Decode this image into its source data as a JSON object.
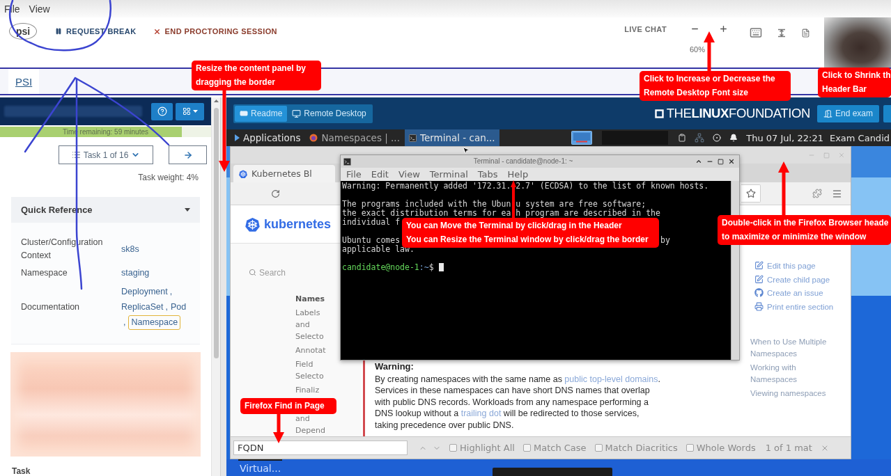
{
  "menu_bar": {
    "items": [
      "File",
      "View"
    ]
  },
  "header": {
    "logo": "psi",
    "actions": [
      {
        "kind": "pause",
        "label": "REQUEST BREAK"
      },
      {
        "kind": "end",
        "label": "END PROCTORING SESSION"
      }
    ],
    "live_chat": "LIVE CHAT",
    "font_zoom": "60%"
  },
  "sub_tabs": [
    {
      "label": "PSI",
      "selected": true
    }
  ],
  "left_panel": {
    "timer": {
      "text": "Time remaining: 59 minutes",
      "level": 0.86
    },
    "task_selector": "Task 1 of 16",
    "task_weight": "Task weight: 4%",
    "quick_reference": {
      "title": "Quick Reference",
      "expanded": true,
      "rows": [
        {
          "kind": "text",
          "label": "Cluster/Configuration Context",
          "value": "sk8s"
        },
        {
          "kind": "text",
          "label": "Namespace",
          "value": "staging"
        },
        {
          "kind": "links",
          "label": "Documentation",
          "separator": ",",
          "links": [
            {
              "text": "Deployment",
              "focused": false
            },
            {
              "text": "ReplicaSet",
              "focused": false
            },
            {
              "text": "Pod",
              "focused": false
            },
            {
              "text": "Namespace",
              "focused": true
            }
          ]
        }
      ]
    },
    "section_heading": "Task"
  },
  "remote_panel": {
    "tabs": [
      {
        "label": "Readme",
        "selected": true
      },
      {
        "label": "Remote Desktop",
        "selected": false
      }
    ],
    "logo": "THE**LINUX**FOUNDATION",
    "end_exam": "End exam"
  },
  "desktop": {
    "taskbar": {
      "items": [
        {
          "kind": "menu",
          "label": "Applications",
          "selected": false
        },
        {
          "kind": "browser",
          "label": "Namespaces | ...",
          "selected": false
        },
        {
          "kind": "terminal",
          "label": "Terminal - can...",
          "selected": true
        }
      ],
      "clock": "Thu 07 Jul, 22:21",
      "user": "Exam Candid"
    },
    "firefox": {
      "tab": "Kubernetes Bl",
      "logo": "kubernetes",
      "search_placeholder": "Search",
      "nav": {
        "heading": "Names",
        "items": [
          {
            "lines": [
              "Labels",
              "and",
              "Selecto"
            ]
          },
          {
            "lines": [
              "Annotat"
            ]
          },
          {
            "lines": [
              "Field",
              "Selecto"
            ]
          },
          {
            "lines": [
              "Finaliz"
            ]
          },
          {
            "lines": [
              "and",
              "Depend"
            ]
          }
        ]
      },
      "warning": {
        "title": "Warning:",
        "parts": [
          {
            "kind": "text",
            "text": "By creating namespaces with the same name as "
          },
          {
            "kind": "link",
            "text": "public top-level"
          },
          {
            "kind": "link",
            "text": "domains"
          },
          {
            "kind": "text",
            "text": ". Services in these namespaces can have short DNS names that overlap with public DNS records. Workloads from any namespace performing a DNS lookup without a "
          },
          {
            "kind": "link",
            "text": "trailing dot"
          },
          {
            "kind": "text",
            "text": " will be redirected to those services, taking precedence over public DNS."
          }
        ]
      },
      "page_actions": [
        "Edit this page",
        "Create child page",
        "Create an issue",
        "Print entire section"
      ],
      "toc": [
        "When to Use Multiple Namespaces",
        "Working with Namespaces",
        "Viewing namespaces"
      ],
      "find_bar": {
        "value": "FQDN",
        "options": [
          {
            "label": "Highlight All",
            "checked": false
          },
          {
            "label": "Match Case",
            "checked": false
          },
          {
            "label": "Match Diacritics",
            "checked": false
          },
          {
            "label": "Whole Words",
            "checked": false
          }
        ],
        "result": "1 of 1 mat"
      }
    },
    "terminal": {
      "title": "Terminal - candidate@node-1: ~",
      "menu": [
        "File",
        "Edit",
        "View",
        "Terminal",
        "Tabs",
        "Help"
      ],
      "lines": [
        {
          "kind": "output",
          "segments": [
            "Warning: Permanently added '172.31.",
            "2.7' (ECDSA) to the list of known hosts."
          ]
        },
        {
          "kind": "blank"
        },
        {
          "kind": "output",
          "segments": [
            "The programs included with the Ubun",
            "u system are free software;"
          ]
        },
        {
          "kind": "output",
          "segments": [
            "the exact distribution terms for ea",
            "h program are described in the"
          ]
        },
        {
          "kind": "output",
          "segments": [
            "individual f"
          ]
        },
        {
          "kind": "blank"
        },
        {
          "kind": "output",
          "segments": [
            "Ubuntu comes",
            "by"
          ]
        },
        {
          "kind": "output",
          "segments": [
            "applicable law."
          ]
        },
        {
          "kind": "blank"
        },
        {
          "kind": "prompt",
          "user": "candidate@node-1",
          "path": ":~",
          "symbol": "$"
        }
      ]
    },
    "bottom_taskbar": {
      "items": [
        "Virtual..."
      ]
    }
  },
  "annotations": [
    {
      "lines": [
        "Resize the content panel by",
        "dragging the border"
      ]
    },
    {
      "lines": [
        "Click to Increase or Decrease the",
        "Remote Desktop Font size"
      ]
    },
    {
      "lines": [
        "Click to Shrink th",
        "Header Bar"
      ]
    },
    {
      "lines": [
        "You can Move the Terminal by click/drag in the Header",
        "You can Resize the Terminal window by click/drag the border"
      ]
    },
    {
      "lines": [
        "Double-click in the Firefox Browser heade",
        "to maximize or minimize the window"
      ]
    },
    {
      "lines": [
        "Firefox Find in Page"
      ]
    }
  ]
}
